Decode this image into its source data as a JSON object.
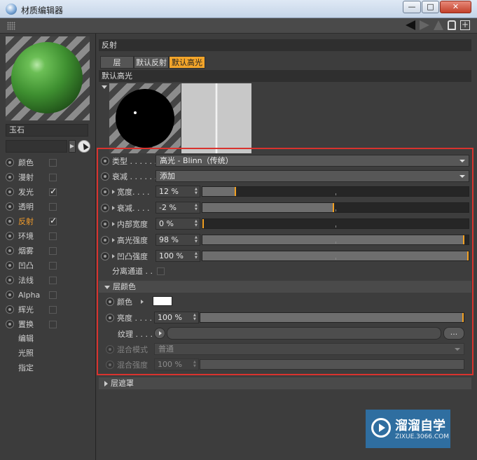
{
  "window": {
    "title": "材质编辑器",
    "minimize": "—",
    "maximize": "□",
    "close": "✕"
  },
  "material": {
    "name": "玉石",
    "preview_color": "#3e8f30"
  },
  "channels": [
    {
      "label": "颜色",
      "checked": false,
      "active": false
    },
    {
      "label": "漫射",
      "checked": false,
      "active": false
    },
    {
      "label": "发光",
      "checked": true,
      "active": false
    },
    {
      "label": "透明",
      "checked": false,
      "active": false
    },
    {
      "label": "反射",
      "checked": true,
      "active": true
    },
    {
      "label": "环境",
      "checked": false,
      "active": false
    },
    {
      "label": "烟雾",
      "checked": false,
      "active": false
    },
    {
      "label": "凹凸",
      "checked": false,
      "active": false
    },
    {
      "label": "法线",
      "checked": false,
      "active": false
    },
    {
      "label": "Alpha",
      "checked": false,
      "active": false
    },
    {
      "label": "辉光",
      "checked": false,
      "active": false
    },
    {
      "label": "置换",
      "checked": false,
      "active": false
    }
  ],
  "extra_items": [
    "编辑",
    "光照",
    "指定"
  ],
  "reflection": {
    "section_title": "反射",
    "tabs": [
      "层",
      "默认反射",
      "默认高光"
    ],
    "selected_tab": "默认高光",
    "layer_title": "默认高光",
    "type_label": "类型 . . . . . .",
    "type_value": "高光 - Blinn（传统）",
    "falloff_label": "衰减 . . . . . .",
    "falloff_value": "添加",
    "params": [
      {
        "label": "宽度. . . .",
        "value": "12 %",
        "fraction": 0.12
      },
      {
        "label": "衰减. . . .",
        "value": "-2 %",
        "fraction": 0.49
      },
      {
        "label": "内部宽度",
        "value": "0 %",
        "fraction": 0.0
      },
      {
        "label": "高光强度",
        "value": "98 %",
        "fraction": 0.98
      },
      {
        "label": "凹凸强度",
        "value": "100 %",
        "fraction": 1.0
      }
    ],
    "separate_pass_label": "分离通道 . .",
    "layer_color": {
      "header": "层颜色",
      "color_label": "颜色",
      "color_value": "#ffffff",
      "brightness_label": "亮度 . . . .",
      "brightness_value": "100 %",
      "brightness_fraction": 1.0,
      "texture_label": "纹理 . . . .",
      "texture_button": "...",
      "blend_mode_label": "混合模式",
      "blend_mode_value": "普通",
      "blend_strength_label": "混合强度",
      "blend_strength_value": "100 %"
    },
    "layer_mask_header": "层遮罩"
  },
  "watermark": {
    "title": "溜溜自学",
    "url": "ZIXUE.3066.COM"
  },
  "colors": {
    "accent": "#f3a52a",
    "highlight_box": "#d9332e"
  }
}
